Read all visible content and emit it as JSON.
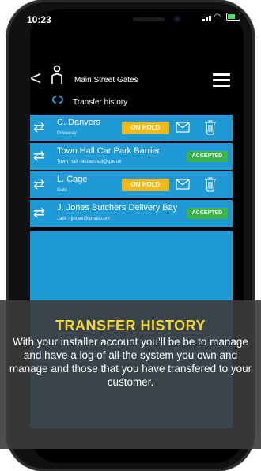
{
  "status": {
    "time": "10:23"
  },
  "header": {
    "site": "Main Street Gates",
    "subtitle": "Transfer history"
  },
  "rows": [
    {
      "name": "C. Danvers",
      "sub": "Driveway",
      "status": "ON HOLD"
    },
    {
      "name": "Town Hall Car Park Barrier",
      "sub": "Town Hall - letownhall@gov.uk",
      "status": "ACCEPTED"
    },
    {
      "name": "L. Cage",
      "sub": "Gate",
      "status": "ON HOLD"
    },
    {
      "name": "J. Jones Butchers Delivery Bay",
      "sub": "Jack - jjones@gmail.com",
      "status": "ACCEPTED"
    }
  ],
  "overlay": {
    "title": "TRANSFER HISTORY",
    "body": "With your installer account you’ll be be to manage and have a log of all the system you own and manage and those that you have transfered to your customer."
  },
  "colors": {
    "accent": "#1e9ad6",
    "on_hold": "#f5b815",
    "accepted": "#3bb54a",
    "title": "#f7d531"
  },
  "icons": [
    "back-chevron-icon",
    "user-icon",
    "menu-icon",
    "transfer-icon",
    "swap-arrows-icon",
    "mail-icon",
    "trash-icon"
  ]
}
